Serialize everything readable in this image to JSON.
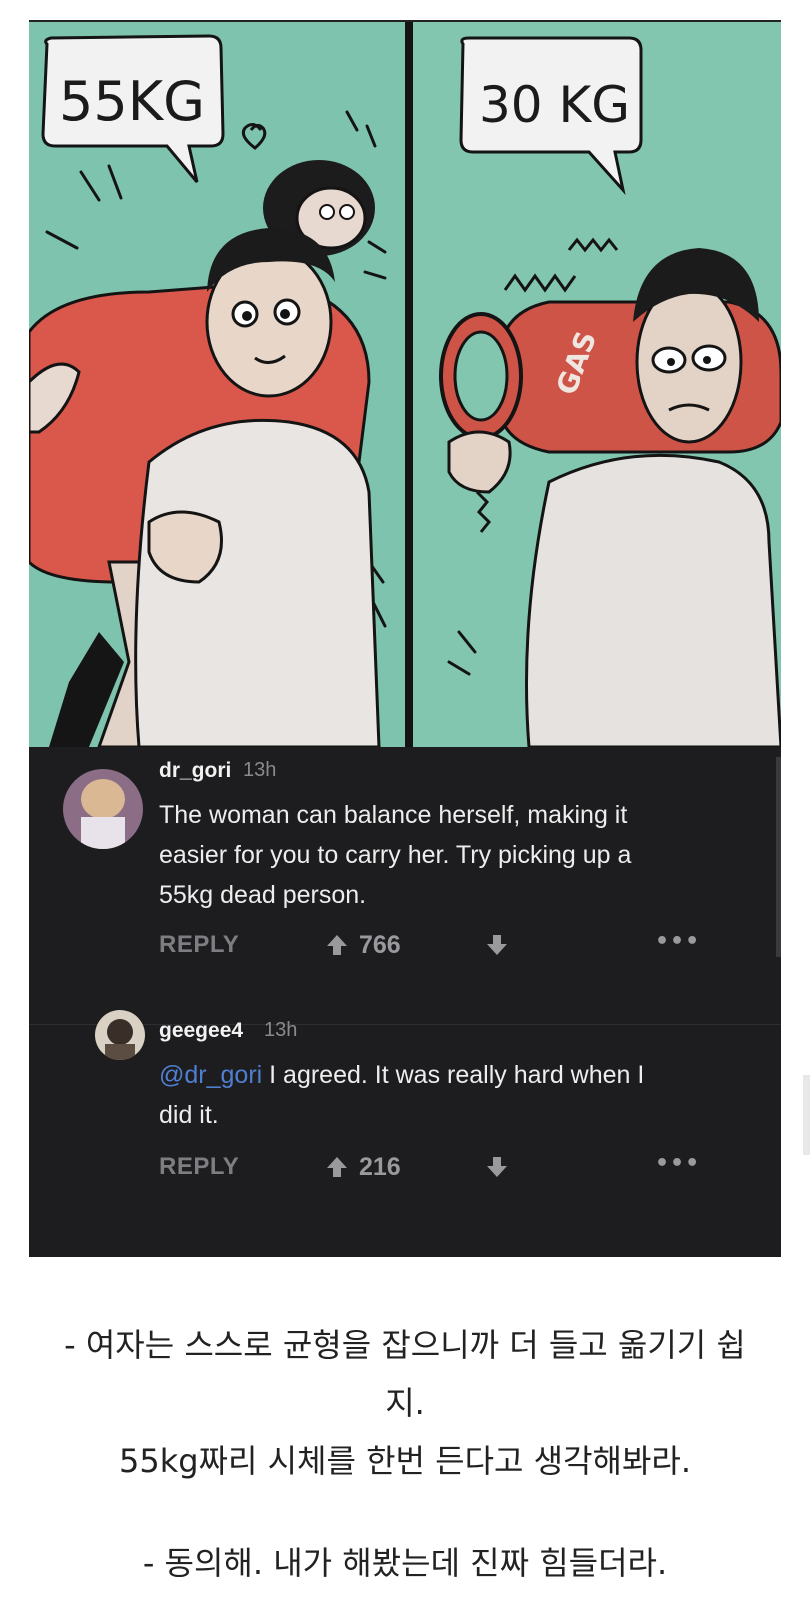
{
  "comic": {
    "left_bubble": "55KG",
    "right_bubble": "30 KG",
    "tank_label": "GAS"
  },
  "comments": [
    {
      "username": "dr_gori",
      "time": "13h",
      "text": "The woman can balance herself, making it easier for you to carry her. Try picking up a 55kg dead person.",
      "lines": [
        "The woman can balance herself, making it",
        "easier for you to carry her. Try picking up a",
        "55kg dead person."
      ],
      "reply_label": "REPLY",
      "upvotes": "766"
    },
    {
      "username": "geegee4",
      "time": "13h",
      "mention": "@dr_gori",
      "line1_rest": " I agreed. It was really hard when I",
      "line2": "did it.",
      "reply_label": "REPLY",
      "upvotes": "216"
    }
  ],
  "caption": {
    "line1": "- 여자는 스스로 균형을 잡으니까 더 들고 옮기기 쉽",
    "line2": "지.",
    "line3": "55kg짜리 시체를 한번 든다고 생각해봐라.",
    "line4": "- 동의해. 내가 해봤는데 진짜 힘들더라."
  },
  "colors": {
    "comic_bg": "#7fc4ae",
    "thread_bg": "#1d1d1f",
    "mention": "#4f7fd0",
    "shirt_red": "#d9584b"
  }
}
